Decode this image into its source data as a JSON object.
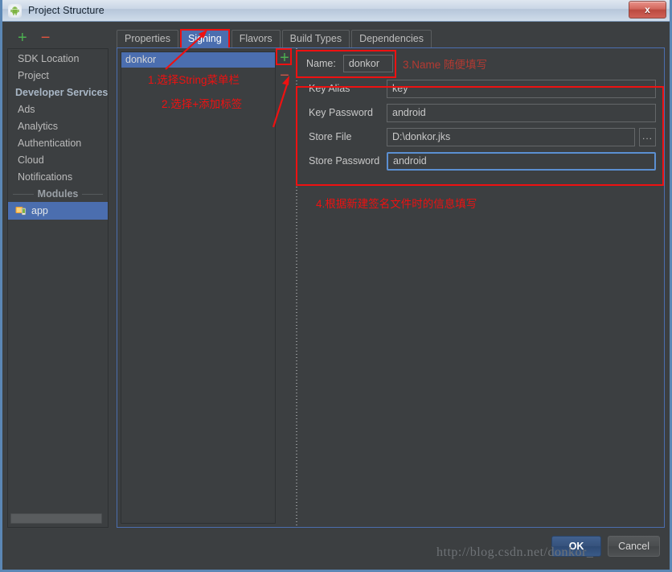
{
  "window": {
    "title": "Project Structure",
    "app_icon": "android-robot-icon",
    "close_label": "x"
  },
  "sidebar": {
    "toolbar": {
      "add_label": "+",
      "remove_label": "−"
    },
    "items": [
      {
        "label": "SDK Location",
        "type": "item"
      },
      {
        "label": "Project",
        "type": "item"
      },
      {
        "label": "Developer Services",
        "type": "group-header"
      },
      {
        "label": "Ads",
        "type": "item"
      },
      {
        "label": "Analytics",
        "type": "item"
      },
      {
        "label": "Authentication",
        "type": "item"
      },
      {
        "label": "Cloud",
        "type": "item"
      },
      {
        "label": "Notifications",
        "type": "item"
      }
    ],
    "modules_separator": "Modules",
    "modules": [
      {
        "label": "app",
        "icon": "android-module-icon",
        "selected": true
      }
    ]
  },
  "tabs": [
    {
      "label": "Properties",
      "active": false
    },
    {
      "label": "Signing",
      "active": true
    },
    {
      "label": "Flavors",
      "active": false
    },
    {
      "label": "Build Types",
      "active": false
    },
    {
      "label": "Dependencies",
      "active": false
    }
  ],
  "signing_list": {
    "items": [
      {
        "label": "donkor",
        "selected": true
      }
    ],
    "add_label": "+",
    "remove_label": "−"
  },
  "form": {
    "name_label": "Name:",
    "name_value": "donkor",
    "fields": [
      {
        "label": "Key Alias",
        "value": "key",
        "focused": false,
        "has_browse": false
      },
      {
        "label": "Key Password",
        "value": "android",
        "focused": false,
        "has_browse": false
      },
      {
        "label": "Store File",
        "value": "D:\\donkor.jks",
        "focused": false,
        "has_browse": true
      },
      {
        "label": "Store Password",
        "value": "android",
        "focused": true,
        "has_browse": false
      }
    ],
    "browse_label": "..."
  },
  "annotations": [
    {
      "id": "a1",
      "text": "1.选择String菜单栏"
    },
    {
      "id": "a2",
      "text": "2.选择+添加标签"
    },
    {
      "id": "a3",
      "text": "3.Name 随便填写"
    },
    {
      "id": "a4",
      "text": "4.根据新建签名文件时的信息填写"
    }
  ],
  "footer": {
    "ok_label": "OK",
    "cancel_label": "Cancel",
    "watermark": "http://blog.csdn.net/donkor_"
  },
  "colors": {
    "accent_blue": "#4b6eaf",
    "annotation_red": "#ee1111",
    "panel_bg": "#3c3f41",
    "add_green": "#4caf50",
    "remove_red": "#e0533f"
  }
}
